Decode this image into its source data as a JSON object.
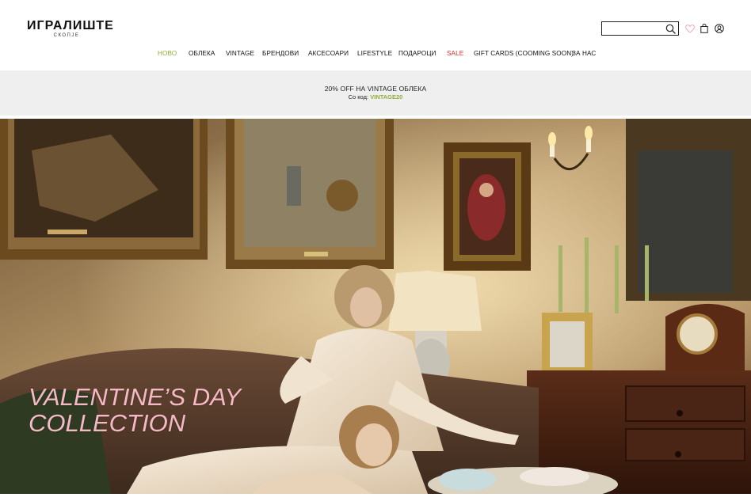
{
  "brand": {
    "name": "ИГРАЛИШТЕ",
    "subtitle": "СКОПЈЕ"
  },
  "search": {
    "value": "",
    "placeholder": ""
  },
  "icons": {
    "search": "search-icon",
    "wishlist": "heart-icon",
    "cart": "shopping-bag-icon",
    "account": "user-icon"
  },
  "nav": {
    "items": [
      {
        "label": "НОВО"
      },
      {
        "label": "ОБЛЕКА"
      },
      {
        "label": "VINTAGE"
      },
      {
        "label": "БРЕНДОВИ"
      },
      {
        "label": "АКСЕСОАРИ"
      },
      {
        "label": "LIFESTYLE"
      },
      {
        "label": "ПОДАРОЦИ"
      },
      {
        "label": "SALE"
      },
      {
        "label": "GIFT CARDS (COOMING SOON)"
      },
      {
        "label": "ЗА НАС"
      }
    ]
  },
  "promo": {
    "headline": "20% OFF НА VINTAGE ОБЛЕКА",
    "code_prefix": "Со код:",
    "code": "VINTAGE20"
  },
  "hero": {
    "title_line1": "VALENTINE’S DAY",
    "title_line2": "COLLECTION"
  },
  "colors": {
    "accent_green": "#8fae3a",
    "sale_red": "#e02b2b",
    "hero_title_pink": "#f4b9c4",
    "promo_bg": "#efefef",
    "wishlist_pink": "#f2a7b8"
  }
}
